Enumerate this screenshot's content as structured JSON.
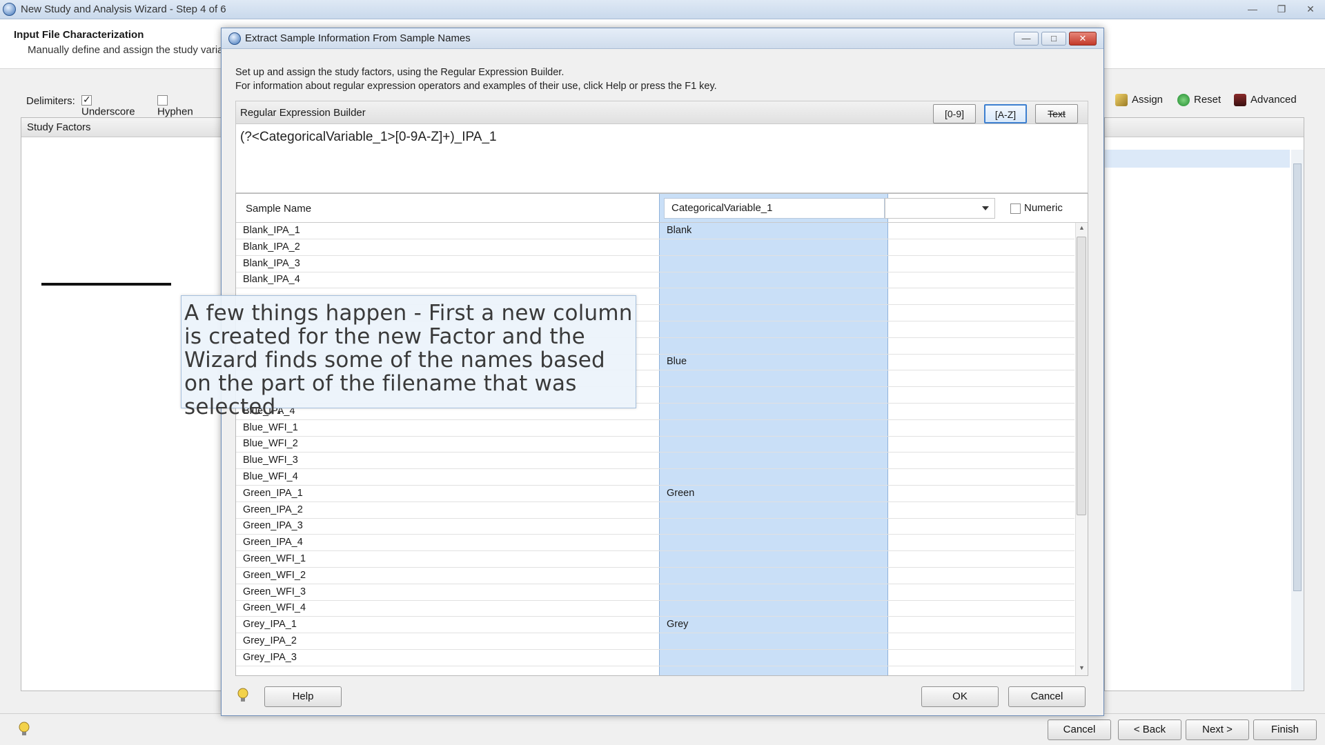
{
  "window": {
    "title": "New Study and Analysis Wizard - Step 4 of 6"
  },
  "header": {
    "title": "Input File Characterization",
    "subtitle": "Manually define and assign the study variables"
  },
  "delimiters": {
    "label": "Delimiters:",
    "underscore": "Underscore",
    "hyphen": "Hyphen"
  },
  "study_factors": {
    "title": "Study Factors"
  },
  "toolbar": {
    "assign": "Assign",
    "reset": "Reset",
    "advanced": "Advanced"
  },
  "footer": {
    "cancel": "Cancel",
    "back": "< Back",
    "next": "Next >",
    "finish": "Finish"
  },
  "dialog": {
    "title": "Extract Sample Information From Sample Names",
    "instruction1": "Set up and assign the study factors, using the Regular Expression Builder.",
    "instruction2": "For information about regular expression operators and examples of their use, click Help or press the F1 key.",
    "builder_label": "Regular Expression Builder",
    "btn_digits": "[0-9]",
    "btn_letters": "[A-Z]",
    "btn_text": "Text",
    "regex": "(?<CategoricalVariable_1>[0-9A-Z]+)_IPA_1",
    "col_sample": "Sample Name",
    "col_variable": "CategoricalVariable_1",
    "numeric_label": "Numeric",
    "help": "Help",
    "ok": "OK",
    "cancel": "Cancel",
    "rows": [
      {
        "name": "Blank_IPA_1",
        "value": "Blank"
      },
      {
        "name": "Blank_IPA_2",
        "value": ""
      },
      {
        "name": "Blank_IPA_3",
        "value": ""
      },
      {
        "name": "Blank_IPA_4",
        "value": ""
      },
      {
        "name": "",
        "value": ""
      },
      {
        "name": "",
        "value": ""
      },
      {
        "name": "",
        "value": ""
      },
      {
        "name": "",
        "value": ""
      },
      {
        "name": "",
        "value": "Blue"
      },
      {
        "name": "",
        "value": ""
      },
      {
        "name": "",
        "value": ""
      },
      {
        "name": "Blue_IPA_4",
        "value": ""
      },
      {
        "name": "Blue_WFI_1",
        "value": ""
      },
      {
        "name": "Blue_WFI_2",
        "value": ""
      },
      {
        "name": "Blue_WFI_3",
        "value": ""
      },
      {
        "name": "Blue_WFI_4",
        "value": ""
      },
      {
        "name": "Green_IPA_1",
        "value": "Green"
      },
      {
        "name": "Green_IPA_2",
        "value": ""
      },
      {
        "name": "Green_IPA_3",
        "value": ""
      },
      {
        "name": "Green_IPA_4",
        "value": ""
      },
      {
        "name": "Green_WFI_1",
        "value": ""
      },
      {
        "name": "Green_WFI_2",
        "value": ""
      },
      {
        "name": "Green_WFI_3",
        "value": ""
      },
      {
        "name": "Green_WFI_4",
        "value": ""
      },
      {
        "name": "Grey_IPA_1",
        "value": "Grey"
      },
      {
        "name": "Grey_IPA_2",
        "value": ""
      },
      {
        "name": "Grey_IPA_3",
        "value": ""
      }
    ]
  },
  "tooltip": {
    "text": "A few things happen - First a new column is created for the new Factor and the Wizard finds some of the names based on the part of the filename that was selected."
  },
  "colors": {
    "highlight_column": "#bad6f5",
    "close_button": "#c2392a",
    "active_button_border": "#3c7fd0"
  }
}
